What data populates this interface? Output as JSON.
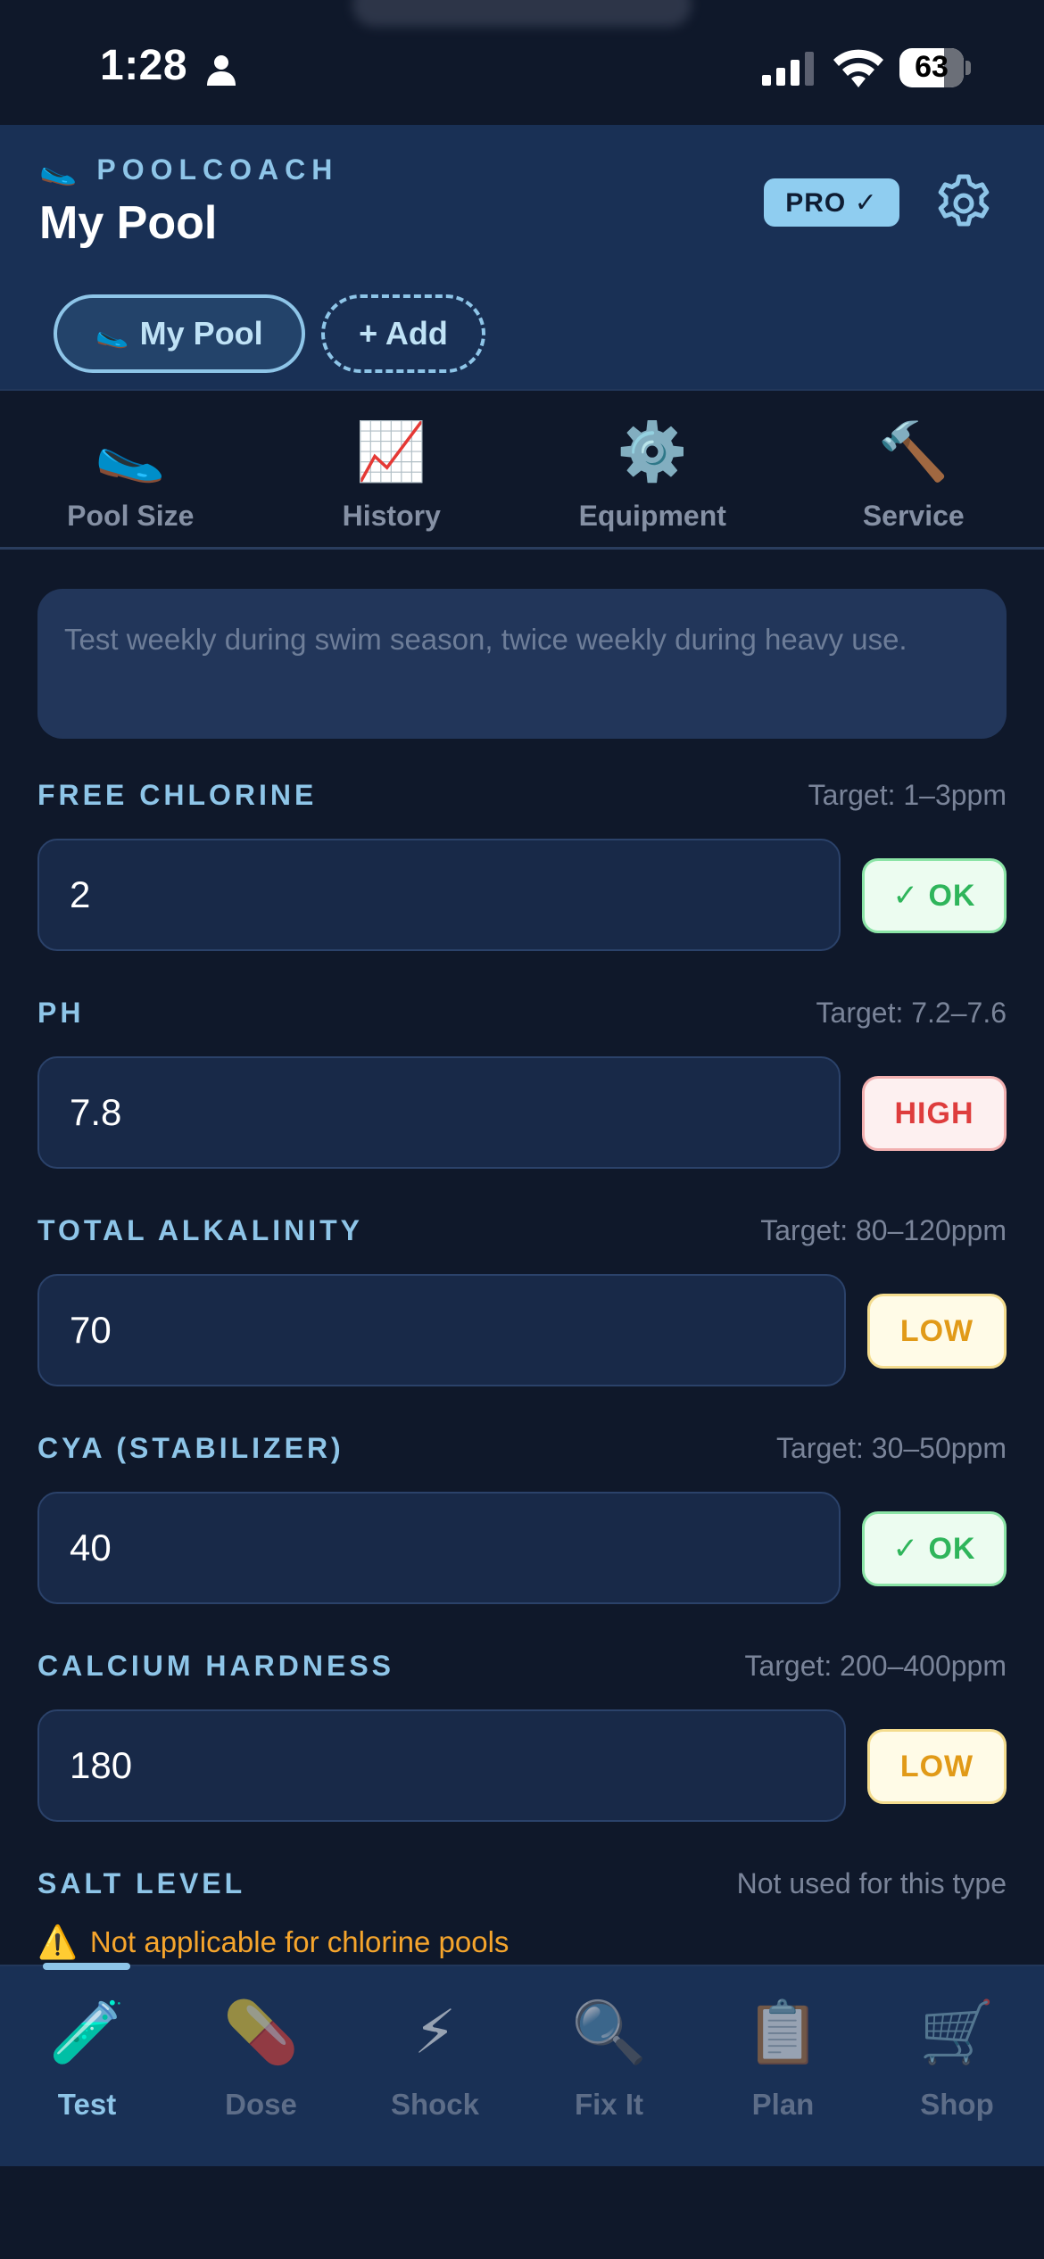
{
  "status_bar": {
    "time": "1:28",
    "battery": "63"
  },
  "header": {
    "brand": "POOLCOACH",
    "brand_icon": "🥿",
    "title": "My Pool",
    "pro_badge": "PRO ✓",
    "pool_chip": "My Pool",
    "add_chip": "+ Add"
  },
  "sub_tabs": [
    {
      "icon": "🥿",
      "label": "Pool Size"
    },
    {
      "icon": "📈",
      "label": "History"
    },
    {
      "icon": "⚙️",
      "label": "Equipment"
    },
    {
      "icon": "🔨",
      "label": "Service"
    }
  ],
  "tip": "Test weekly during swim season, twice weekly during heavy use.",
  "params": [
    {
      "label": "FREE CHLORINE",
      "target": "Target: 1–3ppm",
      "value": "2",
      "status": "✓ OK",
      "status_type": "ok"
    },
    {
      "label": "PH",
      "target": "Target: 7.2–7.6",
      "value": "7.8",
      "status": "HIGH",
      "status_type": "high"
    },
    {
      "label": "TOTAL ALKALINITY",
      "target": "Target: 80–120ppm",
      "value": "70",
      "status": "LOW",
      "status_type": "low"
    },
    {
      "label": "CYA (STABILIZER)",
      "target": "Target: 30–50ppm",
      "value": "40",
      "status": "✓ OK",
      "status_type": "ok"
    },
    {
      "label": "CALCIUM HARDNESS",
      "target": "Target: 200–400ppm",
      "value": "180",
      "status": "LOW",
      "status_type": "low"
    }
  ],
  "salt": {
    "label": "SALT LEVEL",
    "target": "Not used for this type",
    "warning": "Not applicable for chlorine pools",
    "warning_icon": "⚠️"
  },
  "bottom_nav": [
    {
      "icon": "🧪",
      "label": "Test",
      "active": true
    },
    {
      "icon": "💊",
      "label": "Dose",
      "active": false
    },
    {
      "icon": "⚡",
      "label": "Shock",
      "active": false
    },
    {
      "icon": "🔍",
      "label": "Fix It",
      "active": false
    },
    {
      "icon": "📋",
      "label": "Plan",
      "active": false
    },
    {
      "icon": "🛒",
      "label": "Shop",
      "active": false
    }
  ],
  "colors": {
    "background": "#0f182a",
    "header": "#193055",
    "accent": "#8ec5e8",
    "ok": "#2fb55b",
    "high": "#de3d3d",
    "low": "#e19a18"
  }
}
